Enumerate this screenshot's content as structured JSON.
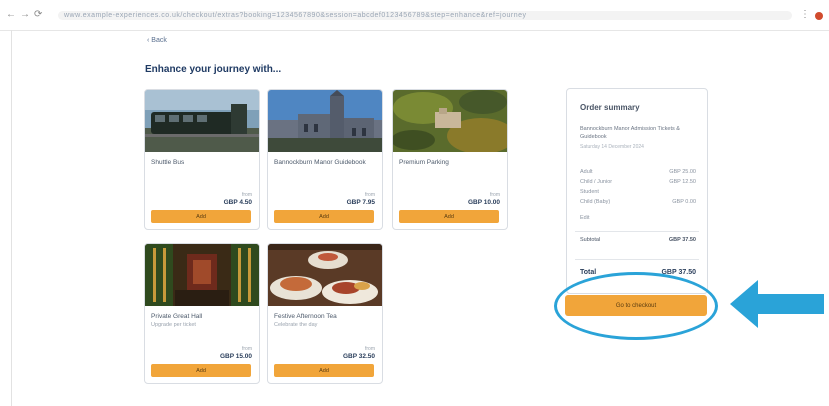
{
  "browser": {
    "back_glyph": "←",
    "forward_glyph": "→",
    "reload_glyph": "⟳",
    "url": "www.example-experiences.co.uk/checkout/extras?booking=1234567890&session=abcdef0123456789&step=enhance&ref=journey",
    "menu_glyph": "⋮"
  },
  "page": {
    "back_link": "‹ Back",
    "title": "Enhance your journey with...",
    "accent_color": "#f1a53a",
    "link_color": "#1f3a63"
  },
  "cards": [
    {
      "name": "Shuttle Bus",
      "subtitle": "",
      "from": "from",
      "price": "GBP 4.50",
      "button": "Add",
      "image": "train-photo"
    },
    {
      "name": "Bannockburn Manor Guidebook",
      "subtitle": "",
      "from": "from",
      "price": "GBP 7.95",
      "button": "Add",
      "image": "castle-photo"
    },
    {
      "name": "Premium Parking",
      "subtitle": "",
      "from": "from",
      "price": "GBP 10.00",
      "button": "Add",
      "image": "estate-aerial-photo"
    },
    {
      "name": "Private Great Hall",
      "subtitle": "Upgrade per ticket",
      "from": "from",
      "price": "GBP 15.00",
      "button": "Add",
      "image": "great-hall-photo"
    },
    {
      "name": "Festive Afternoon Tea",
      "subtitle": "Celebrate the day",
      "from": "from",
      "price": "GBP 32.50",
      "button": "Add",
      "image": "afternoon-tea-photo"
    }
  ],
  "summary": {
    "title": "Order summary",
    "item": "Bannockburn Manor Admission Tickets & Guidebook",
    "date": "Saturday 14 December 2024",
    "lines": [
      {
        "label": "Adult",
        "amount": "GBP 25.00"
      },
      {
        "label": "Child / Junior",
        "amount": "GBP 12.50"
      },
      {
        "label": "Student",
        "amount": ""
      },
      {
        "label": "Child (Baby)",
        "amount": "GBP 0.00"
      }
    ],
    "promo": "Edit",
    "subtotal_label": "Subtotal",
    "subtotal_amount": "GBP 37.50",
    "total_label": "Total",
    "total_amount": "GBP 37.50"
  },
  "checkout": {
    "label": "Go to checkout"
  },
  "annotation": {
    "ellipse_color": "#2aa3d8",
    "arrow_color": "#2aa3d8"
  }
}
